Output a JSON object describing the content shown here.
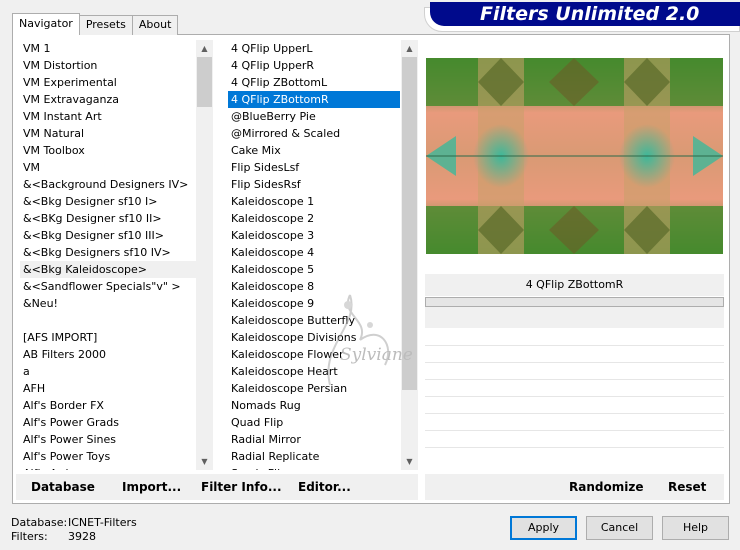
{
  "tabs": [
    {
      "label": "Navigator"
    },
    {
      "label": "Presets"
    },
    {
      "label": "About"
    }
  ],
  "header": {
    "title": "Filters Unlimited 2.0"
  },
  "categories": {
    "items": [
      "VM 1",
      "VM Distortion",
      "VM Experimental",
      "VM Extravaganza",
      "VM Instant Art",
      "VM Natural",
      "VM Toolbox",
      "VM",
      "&<Background Designers IV>",
      "&<Bkg Designer sf10 I>",
      "&<BKg Designer sf10 II>",
      "&<Bkg Designer sf10 III>",
      "&<Bkg Designers sf10 IV>",
      "&<Bkg Kaleidoscope>",
      "&<Sandflower Specials\"v\" >",
      "&Neu!",
      "",
      "[AFS IMPORT]",
      "AB Filters 2000",
      "a",
      "AFH",
      "Alf's Border FX",
      "Alf's Power Grads",
      "Alf's Power Sines",
      "Alf's Power Toys",
      "Alf's Ard"
    ],
    "highlighted": "&<Bkg Kaleidoscope>"
  },
  "filters": {
    "items": [
      "4 QFlip UpperL",
      "4 QFlip UpperR",
      "4 QFlip ZBottomL",
      "4 QFlip ZBottomR",
      "@BlueBerry Pie",
      "@Mirrored & Scaled",
      "Cake Mix",
      "Flip SidesLsf",
      "Flip SidesRsf",
      "Kaleidoscope 1",
      "Kaleidoscope 2",
      "Kaleidoscope 3",
      "Kaleidoscope 4",
      "Kaleidoscope 5",
      "Kaleidoscope 8",
      "Kaleidoscope 9",
      "Kaleidoscope Butterfly",
      "Kaleidoscope Divisions",
      "Kaleidoscope Flower",
      "Kaleidoscope Heart",
      "Kaleidoscope Persian",
      "Nomads Rug",
      "Quad Flip",
      "Radial Mirror",
      "Radial Replicate",
      "Seeds Flip"
    ],
    "selected": "4 QFlip ZBottomR"
  },
  "preview": {
    "filter_name": "4 QFlip ZBottomR",
    "colors": {
      "salmon": "#e99a7c",
      "green": "#2e8a2c",
      "teal": "#3db89a",
      "olive": "#8f8a3d"
    }
  },
  "toolbar": {
    "database_label": "Database",
    "import_label": "Import...",
    "filter_info_label": "Filter Info...",
    "editor_label": "Editor...",
    "randomize_label": "Randomize",
    "reset_label": "Reset"
  },
  "status": {
    "database_label": "Database:",
    "database_value": "ICNET-Filters",
    "filters_label": "Filters:",
    "filters_value": "3928"
  },
  "buttons": {
    "apply": "Apply",
    "cancel": "Cancel",
    "help": "Help"
  },
  "watermark": {
    "text": "Sylviane"
  },
  "accent_color": "#0078d7"
}
